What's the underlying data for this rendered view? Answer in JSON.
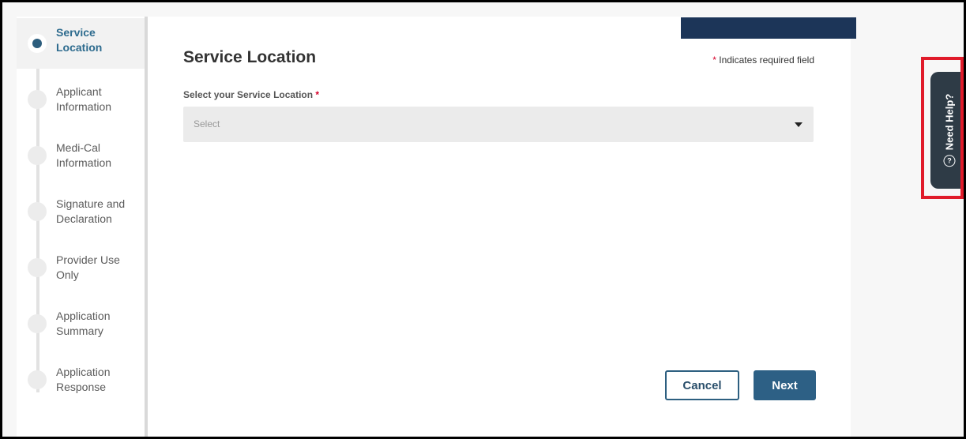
{
  "steps": [
    {
      "label": "Service Location",
      "active": true
    },
    {
      "label": "Applicant Information",
      "active": false
    },
    {
      "label": "Medi-Cal Information",
      "active": false
    },
    {
      "label": "Signature and Declaration",
      "active": false
    },
    {
      "label": "Provider Use Only",
      "active": false
    },
    {
      "label": "Application Summary",
      "active": false
    },
    {
      "label": "Application Response",
      "active": false
    }
  ],
  "page": {
    "title": "Service Location",
    "required_star": "*",
    "required_note": "Indicates required field"
  },
  "field": {
    "label": "Select your Service Location",
    "required_star": "*",
    "selected_value": "Select"
  },
  "buttons": {
    "cancel": "Cancel",
    "next": "Next"
  },
  "help": {
    "label": "Need Help?",
    "icon": "question-circle-icon"
  },
  "colors": {
    "accent": "#2d6085",
    "header_bar": "#1c3558",
    "highlight": "#e01b2a",
    "help_tab": "#2e3b46"
  }
}
